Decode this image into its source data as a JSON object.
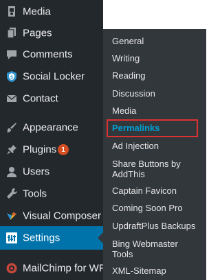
{
  "menu": {
    "items": [
      {
        "label": "Media",
        "icon": "media-icon"
      },
      {
        "label": "Pages",
        "icon": "pages-icon"
      },
      {
        "label": "Comments",
        "icon": "comments-icon"
      },
      {
        "label": "Social Locker",
        "icon": "shield-icon"
      },
      {
        "label": "Contact",
        "icon": "envelope-icon"
      },
      {
        "label": "Appearance",
        "icon": "paintbrush-icon"
      },
      {
        "label": "Plugins",
        "icon": "plugin-icon",
        "badge": "1"
      },
      {
        "label": "Users",
        "icon": "users-icon"
      },
      {
        "label": "Tools",
        "icon": "wrench-icon"
      },
      {
        "label": "Visual Composer",
        "icon": "visual-composer-icon"
      },
      {
        "label": "Settings",
        "icon": "settings-icon",
        "active": true
      },
      {
        "label": "MailChimp for WP",
        "icon": "mailchimp-icon"
      }
    ]
  },
  "settings_submenu": {
    "items": [
      "General",
      "Writing",
      "Reading",
      "Discussion",
      "Media",
      "Permalinks",
      "Ad Injection",
      "Share Buttons by",
      "AddThis",
      "Captain Favicon",
      "Coming Soon Pro",
      "UpdraftPlus Backups",
      "Bing Webmaster",
      "Tools",
      "XML-Sitemap"
    ],
    "current": "Permalinks"
  },
  "colors": {
    "menu_bg": "#23282d",
    "submenu_bg": "#32373c",
    "active_bg": "#0073aa",
    "current_link": "#00a0d2",
    "highlight_box": "#dc3232",
    "badge": "#d54e21"
  }
}
